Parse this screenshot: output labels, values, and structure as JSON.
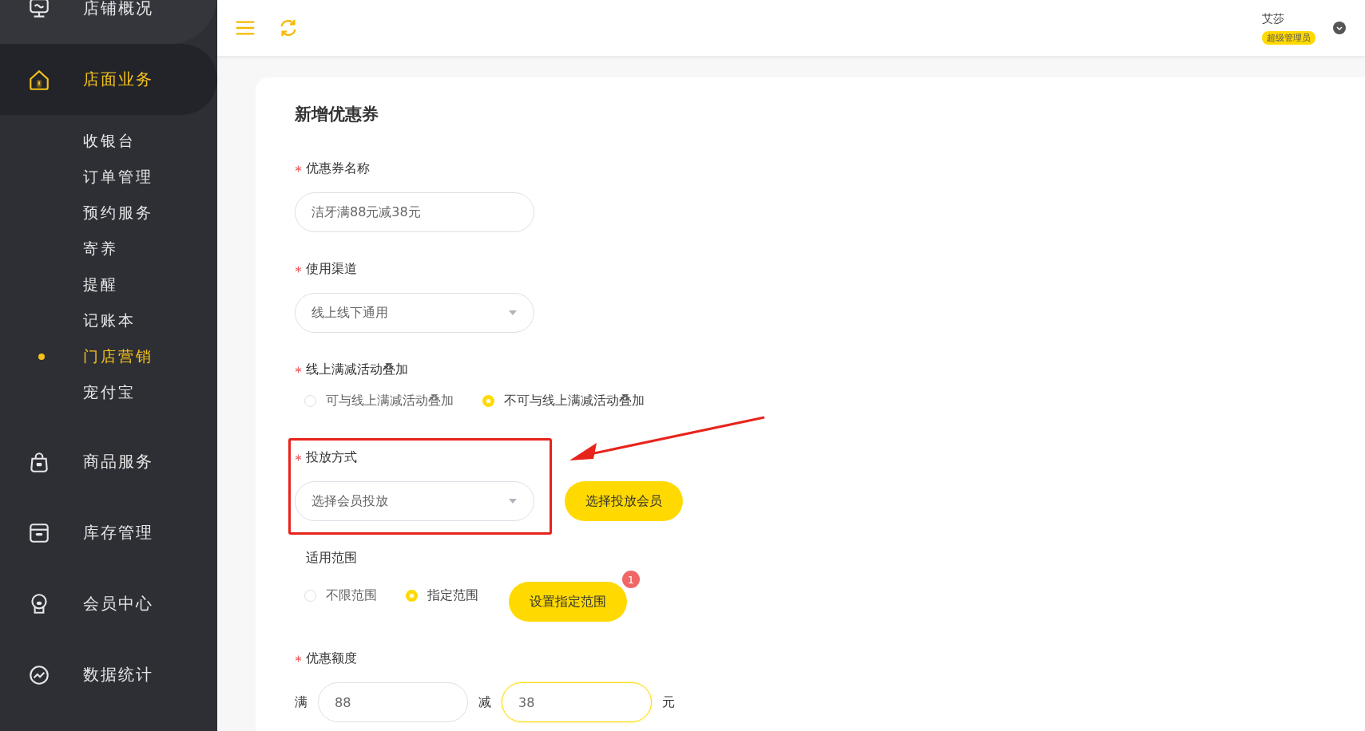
{
  "sidebar": {
    "items": [
      {
        "label": "店铺概况",
        "selected": false
      },
      {
        "label": "店面业务",
        "selected": true,
        "children": [
          {
            "label": "收银台",
            "selected": false
          },
          {
            "label": "订单管理",
            "selected": false
          },
          {
            "label": "预约服务",
            "selected": false
          },
          {
            "label": "寄养",
            "selected": false
          },
          {
            "label": "提醒",
            "selected": false
          },
          {
            "label": "记账本",
            "selected": false
          },
          {
            "label": "门店营销",
            "selected": true
          },
          {
            "label": "宠付宝",
            "selected": false
          }
        ]
      },
      {
        "label": "商品服务",
        "selected": false
      },
      {
        "label": "库存管理",
        "selected": false
      },
      {
        "label": "会员中心",
        "selected": false
      },
      {
        "label": "数据统计",
        "selected": false
      }
    ]
  },
  "header": {
    "user_name": "艾莎",
    "role_badge": "超级管理员"
  },
  "form": {
    "title": "新增优惠券",
    "fields": [
      {
        "kind": "input",
        "label": "优惠券名称",
        "required": true,
        "value": "洁牙满88元减38元"
      },
      {
        "kind": "select",
        "label": "使用渠道",
        "required": true,
        "value": "线上线下通用"
      },
      {
        "kind": "radio",
        "label": "线上满减活动叠加",
        "required": true,
        "options": [
          {
            "label": "可与线上满减活动叠加",
            "selected": false
          },
          {
            "label": "不可与线上满减活动叠加",
            "selected": true
          }
        ]
      },
      {
        "kind": "select",
        "label": "投放方式",
        "required": true,
        "value": "选择会员投放",
        "highlighted": true,
        "button": "选择投放会员"
      },
      {
        "kind": "radio",
        "label": "适用范围",
        "required": false,
        "options": [
          {
            "label": "不限范围",
            "selected": false
          },
          {
            "label": "指定范围",
            "selected": true
          }
        ],
        "button": "设置指定范围",
        "badge": "1"
      },
      {
        "kind": "amount",
        "label": "优惠额度",
        "required": true,
        "prefix": "满",
        "min_value": "88",
        "middle": "减",
        "discount_value": "38",
        "suffix": "元"
      }
    ]
  }
}
